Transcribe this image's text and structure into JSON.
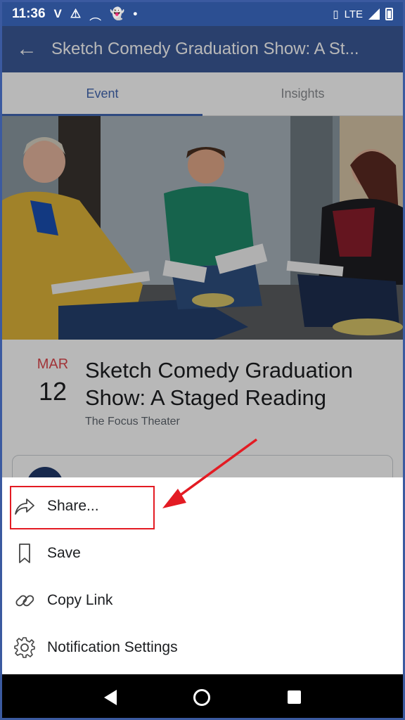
{
  "status": {
    "time": "11:36",
    "network": "LTE",
    "icons": [
      "verizon-icon",
      "alert-icon",
      "cast-icon",
      "snapchat-icon",
      "dot-icon",
      "vibrate-icon",
      "signal-icon",
      "battery-icon"
    ]
  },
  "appbar": {
    "title": "Sketch Comedy Graduation Show: A St..."
  },
  "tabs": [
    {
      "label": "Event",
      "active": true
    },
    {
      "label": "Insights",
      "active": false
    }
  ],
  "event": {
    "month": "MAR",
    "day": "12",
    "title": "Sketch Comedy Graduation Show: A Staged Reading",
    "venue": "The Focus Theater"
  },
  "sheet": {
    "items": [
      {
        "label": "Share...",
        "icon": "share-icon"
      },
      {
        "label": "Save",
        "icon": "bookmark-icon"
      },
      {
        "label": "Copy Link",
        "icon": "link-icon"
      },
      {
        "label": "Notification Settings",
        "icon": "gear-icon"
      }
    ]
  },
  "colors": {
    "statusbar": "#2c4f92",
    "appbar": "#3b5998",
    "accent": "#4267b2",
    "month": "#e0484e",
    "annotation": "#e31b23"
  }
}
